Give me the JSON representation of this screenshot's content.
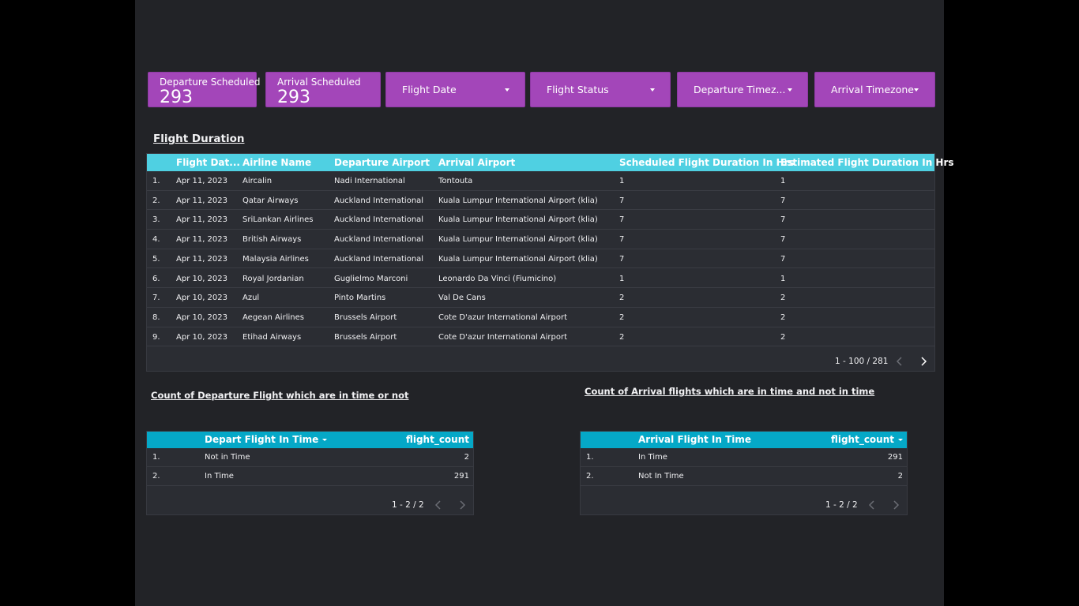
{
  "scorecards": [
    {
      "label": "Departure Scheduled",
      "value": "293"
    },
    {
      "label": "Arrival Scheduled",
      "value": "293"
    }
  ],
  "filters": [
    {
      "label": "Flight Date"
    },
    {
      "label": "Flight Status"
    },
    {
      "label": "Departure Timez..."
    },
    {
      "label": "Arrival Timezone"
    }
  ],
  "flight_duration": {
    "title": "Flight Duration",
    "columns": [
      "Flight Dat...",
      "Airline Name",
      "Departure Airport",
      "Arrival Airport",
      "Scheduled Flight Duration In Hrs",
      "Estimated Flight Duration In Hrs"
    ],
    "rows": [
      {
        "n": "1.",
        "date": "Apr 11, 2023",
        "airline": "Aircalin",
        "dep": "Nadi International",
        "arr": "Tontouta",
        "sched": "1",
        "est": "1"
      },
      {
        "n": "2.",
        "date": "Apr 11, 2023",
        "airline": "Qatar Airways",
        "dep": "Auckland International",
        "arr": "Kuala Lumpur International Airport (klia)",
        "sched": "7",
        "est": "7"
      },
      {
        "n": "3.",
        "date": "Apr 11, 2023",
        "airline": "SriLankan Airlines",
        "dep": "Auckland International",
        "arr": "Kuala Lumpur International Airport (klia)",
        "sched": "7",
        "est": "7"
      },
      {
        "n": "4.",
        "date": "Apr 11, 2023",
        "airline": "British Airways",
        "dep": "Auckland International",
        "arr": "Kuala Lumpur International Airport (klia)",
        "sched": "7",
        "est": "7"
      },
      {
        "n": "5.",
        "date": "Apr 11, 2023",
        "airline": "Malaysia Airlines",
        "dep": "Auckland International",
        "arr": "Kuala Lumpur International Airport (klia)",
        "sched": "7",
        "est": "7"
      },
      {
        "n": "6.",
        "date": "Apr 10, 2023",
        "airline": "Royal Jordanian",
        "dep": "Guglielmo Marconi",
        "arr": "Leonardo Da Vinci (Fiumicino)",
        "sched": "1",
        "est": "1"
      },
      {
        "n": "7.",
        "date": "Apr 10, 2023",
        "airline": "Azul",
        "dep": "Pinto Martins",
        "arr": "Val De Cans",
        "sched": "2",
        "est": "2"
      },
      {
        "n": "8.",
        "date": "Apr 10, 2023",
        "airline": "Aegean Airlines",
        "dep": "Brussels Airport",
        "arr": "Cote D'azur International Airport",
        "sched": "2",
        "est": "2"
      },
      {
        "n": "9.",
        "date": "Apr 10, 2023",
        "airline": "Etihad Airways",
        "dep": "Brussels Airport",
        "arr": "Cote D'azur International Airport",
        "sched": "2",
        "est": "2"
      }
    ],
    "pagination": "1 - 100 / 281"
  },
  "departure_table": {
    "title": "Count of Departure Flight which are in time or not",
    "col_dim": "Depart Flight In Time",
    "col_metric": "flight_count",
    "rows": [
      {
        "n": "1.",
        "label": "Not in Time",
        "count": "2"
      },
      {
        "n": "2.",
        "label": "In Time",
        "count": "291"
      }
    ],
    "pagination": "1 - 2 / 2"
  },
  "arrival_table": {
    "title": "Count of Arrival flights which are in time and not in time",
    "col_dim": "Arrival Flight In Time",
    "col_metric": "flight_count",
    "rows": [
      {
        "n": "1.",
        "label": "In Time",
        "count": "291"
      },
      {
        "n": "2.",
        "label": "Not In Time",
        "count": "2"
      }
    ],
    "pagination": "1 - 2 / 2"
  },
  "colors": {
    "page_bg": "#000000",
    "canvas_bg": "#222327",
    "control_purple": "#a346b9",
    "header_cyan": "#4fd0e2",
    "small_header_cyan": "#05a8c7"
  }
}
